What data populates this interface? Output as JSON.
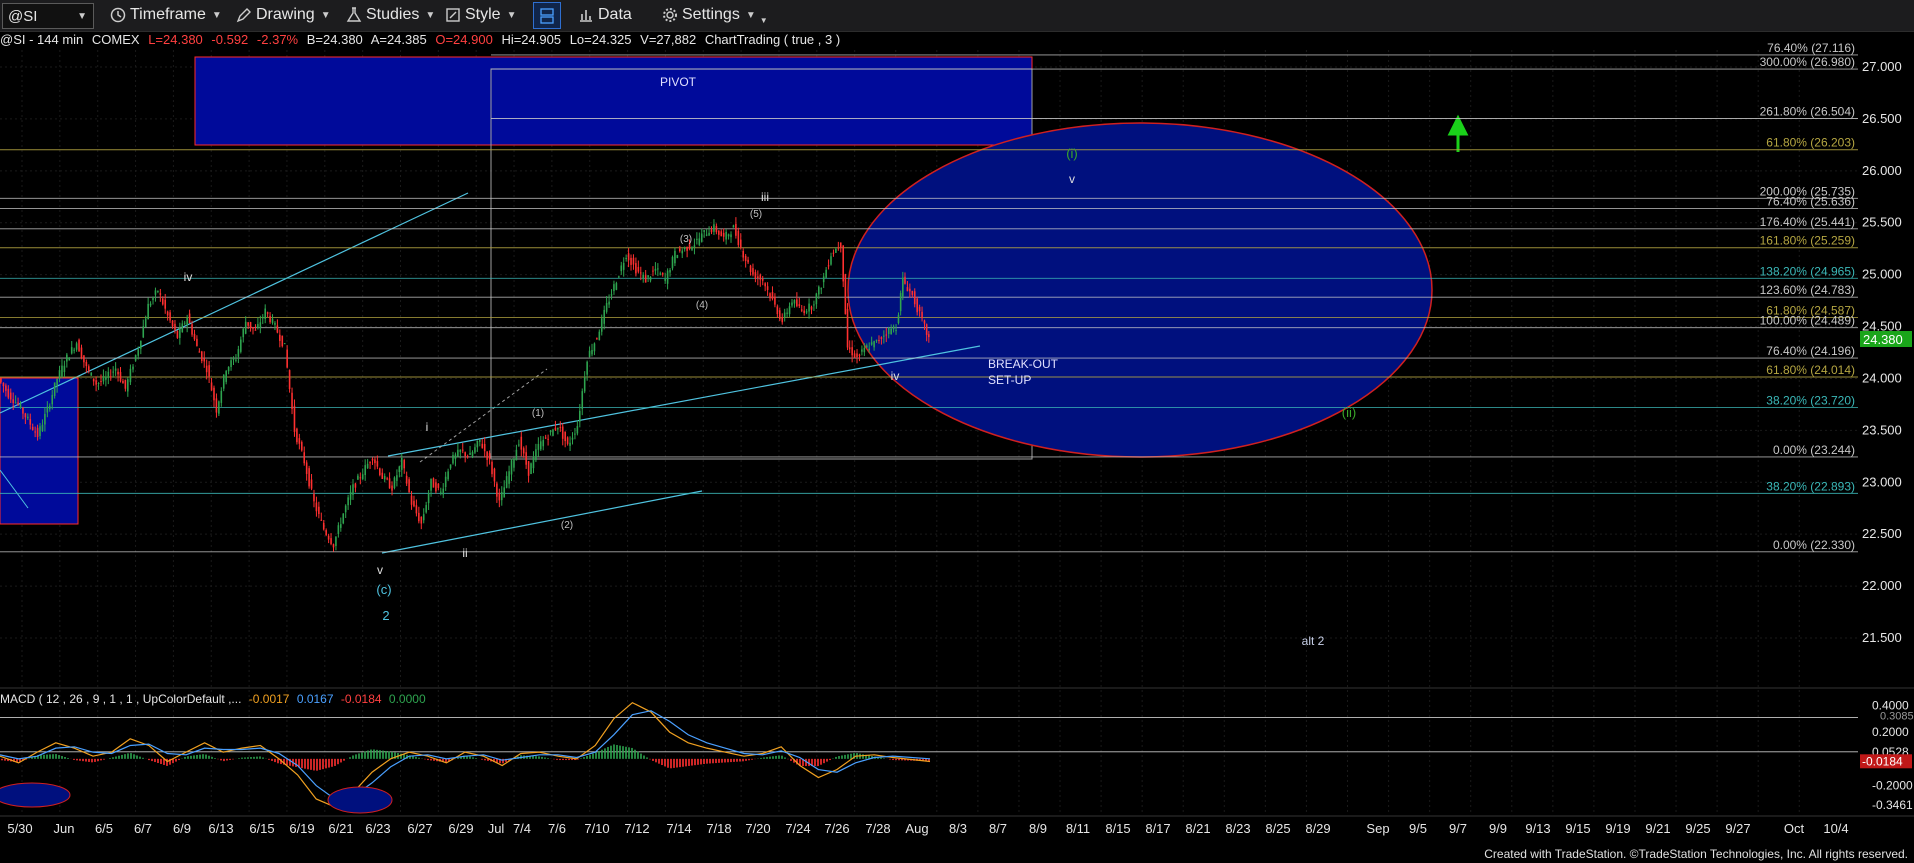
{
  "toolbar": {
    "symbol": "@SI",
    "timeframe": "Timeframe",
    "drawing": "Drawing",
    "studies": "Studies",
    "style": "Style",
    "data": "Data",
    "settings": "Settings"
  },
  "status": {
    "symbol": "@SI - 144 min",
    "exchange": "COMEX",
    "last": "L=24.380",
    "change": "-0.592",
    "change_pct": "-2.37%",
    "bid": "B=24.380",
    "ask": "A=24.385",
    "open": "O=24.900",
    "high": "Hi=24.905",
    "low": "Lo=24.325",
    "volume": "V=27,882",
    "study": "ChartTrading ( true , 3 )"
  },
  "macd_header": {
    "label": "MACD ( 12 , 26 , 9 , 1 , 1 , UpColorDefault ,...",
    "v1": "-0.0017",
    "v2": "0.0167",
    "v3": "-0.0184",
    "v4": "0.0000"
  },
  "footer": "Created with TradeStation. ©TradeStation Technologies, Inc. All rights reserved.",
  "colors": {
    "up": "#2ea44f",
    "down": "#ff3030",
    "price_tag": "#1aa51a",
    "fib_line": "#c8c8c8",
    "box_fill": "#000a9a",
    "ellipse_fill": "#00107e",
    "trend": "#4fc3e0",
    "green_label": "#3aa82a"
  },
  "chart_data": {
    "type": "candlestick",
    "instrument": "@SI - 144 min",
    "y_axis": {
      "ylim": [
        21.0,
        27.2
      ],
      "ticks": [
        "27.000",
        "26.500",
        "26.000",
        "25.500",
        "25.000",
        "24.500",
        "24.000",
        "23.500",
        "23.000",
        "22.500",
        "22.000",
        "21.500"
      ],
      "tick_values": [
        27.0,
        26.5,
        26.0,
        25.5,
        25.0,
        24.5,
        24.0,
        23.5,
        23.0,
        22.5,
        22.0,
        21.5
      ],
      "last_price_label": "24.380",
      "last_price": 24.38
    },
    "x_axis": {
      "labels": [
        "5/30",
        "Jun",
        "6/5",
        "6/7",
        "6/9",
        "6/13",
        "6/15",
        "6/19",
        "6/21",
        "6/23",
        "6/27",
        "6/29",
        "Jul",
        "7/4",
        "7/6",
        "7/10",
        "7/12",
        "7/14",
        "7/18",
        "7/20",
        "7/24",
        "7/26",
        "7/28",
        "Aug",
        "8/3",
        "8/7",
        "8/9",
        "8/11",
        "8/15",
        "8/17",
        "8/21",
        "8/23",
        "8/25",
        "8/29",
        "Sep",
        "9/5",
        "9/7",
        "9/9",
        "9/13",
        "9/15",
        "9/19",
        "9/21",
        "9/25",
        "9/27",
        "Oct",
        "10/4"
      ]
    },
    "price_path": [
      [
        0,
        24.0
      ],
      [
        0.006,
        23.85
      ],
      [
        0.012,
        23.75
      ],
      [
        0.018,
        23.6
      ],
      [
        0.024,
        23.45
      ],
      [
        0.03,
        23.7
      ],
      [
        0.036,
        24.0
      ],
      [
        0.042,
        24.2
      ],
      [
        0.048,
        24.35
      ],
      [
        0.054,
        24.1
      ],
      [
        0.06,
        23.95
      ],
      [
        0.066,
        24.0
      ],
      [
        0.072,
        24.1
      ],
      [
        0.078,
        23.9
      ],
      [
        0.086,
        24.3
      ],
      [
        0.092,
        24.7
      ],
      [
        0.098,
        24.85
      ],
      [
        0.104,
        24.6
      ],
      [
        0.11,
        24.4
      ],
      [
        0.116,
        24.6
      ],
      [
        0.122,
        24.3
      ],
      [
        0.128,
        24.1
      ],
      [
        0.134,
        23.7
      ],
      [
        0.14,
        24.1
      ],
      [
        0.146,
        24.2
      ],
      [
        0.152,
        24.55
      ],
      [
        0.158,
        24.45
      ],
      [
        0.164,
        24.65
      ],
      [
        0.17,
        24.5
      ],
      [
        0.176,
        24.3
      ],
      [
        0.182,
        23.5
      ],
      [
        0.188,
        23.2
      ],
      [
        0.194,
        22.8
      ],
      [
        0.2,
        22.55
      ],
      [
        0.206,
        22.4
      ],
      [
        0.212,
        22.7
      ],
      [
        0.218,
        22.95
      ],
      [
        0.224,
        23.1
      ],
      [
        0.23,
        23.25
      ],
      [
        0.236,
        23.05
      ],
      [
        0.242,
        22.95
      ],
      [
        0.248,
        23.2
      ],
      [
        0.254,
        22.8
      ],
      [
        0.26,
        22.6
      ],
      [
        0.266,
        23.0
      ],
      [
        0.272,
        22.9
      ],
      [
        0.278,
        23.2
      ],
      [
        0.284,
        23.3
      ],
      [
        0.29,
        23.25
      ],
      [
        0.296,
        23.4
      ],
      [
        0.302,
        23.2
      ],
      [
        0.308,
        22.8
      ],
      [
        0.314,
        23.1
      ],
      [
        0.32,
        23.4
      ],
      [
        0.326,
        23.1
      ],
      [
        0.332,
        23.35
      ],
      [
        0.338,
        23.45
      ],
      [
        0.344,
        23.55
      ],
      [
        0.35,
        23.35
      ],
      [
        0.356,
        23.55
      ],
      [
        0.362,
        24.2
      ],
      [
        0.368,
        24.4
      ],
      [
        0.374,
        24.7
      ],
      [
        0.38,
        24.95
      ],
      [
        0.386,
        25.2
      ],
      [
        0.392,
        25.05
      ],
      [
        0.398,
        24.95
      ],
      [
        0.404,
        25.05
      ],
      [
        0.41,
        24.95
      ],
      [
        0.416,
        25.2
      ],
      [
        0.422,
        25.25
      ],
      [
        0.428,
        25.3
      ],
      [
        0.434,
        25.4
      ],
      [
        0.44,
        25.45
      ],
      [
        0.446,
        25.35
      ],
      [
        0.452,
        25.45
      ],
      [
        0.458,
        25.2
      ],
      [
        0.464,
        25.0
      ],
      [
        0.47,
        24.95
      ],
      [
        0.476,
        24.75
      ],
      [
        0.482,
        24.55
      ],
      [
        0.488,
        24.75
      ],
      [
        0.494,
        24.65
      ],
      [
        0.5,
        24.7
      ],
      [
        0.506,
        24.9
      ],
      [
        0.512,
        25.2
      ],
      [
        0.518,
        25.3
      ],
      [
        0.522,
        24.3
      ],
      [
        0.528,
        24.2
      ],
      [
        0.534,
        24.3
      ],
      [
        0.54,
        24.35
      ],
      [
        0.546,
        24.45
      ],
      [
        0.552,
        24.5
      ],
      [
        0.556,
        24.95
      ],
      [
        0.562,
        24.8
      ],
      [
        0.568,
        24.55
      ],
      [
        0.572,
        24.38
      ]
    ],
    "fib_levels_right": [
      {
        "label": "76.40% (27.116)",
        "value": 27.116,
        "color": "#c8c8c8"
      },
      {
        "label": "300.00% (26.980)",
        "value": 26.98,
        "color": "#c8c8c8"
      },
      {
        "label": "261.80% (26.504)",
        "value": 26.504,
        "color": "#c8c8c8"
      },
      {
        "label": "61.80% (26.203)",
        "value": 26.203,
        "color": "#b5a642"
      },
      {
        "label": "200.00% (25.735)",
        "value": 25.735,
        "color": "#c8c8c8"
      },
      {
        "label": "76.40% (25.636)",
        "value": 25.636,
        "color": "#c8c8c8"
      },
      {
        "label": "176.40% (25.441)",
        "value": 25.441,
        "color": "#c8c8c8"
      },
      {
        "label": "161.80% (25.259)",
        "value": 25.259,
        "color": "#b5a642"
      },
      {
        "label": "138.20% (24.965)",
        "value": 24.965,
        "color": "#3bb8b8"
      },
      {
        "label": "123.60% (24.783)",
        "value": 24.783,
        "color": "#c8c8c8"
      },
      {
        "label": "61.80% (24.587)",
        "value": 24.587,
        "color": "#b5a642"
      },
      {
        "label": "100.00% (24.489)",
        "value": 24.489,
        "color": "#c8c8c8"
      },
      {
        "label": "76.40% (24.196)",
        "value": 24.196,
        "color": "#c8c8c8"
      },
      {
        "label": "61.80% (24.014)",
        "value": 24.014,
        "color": "#b5a642"
      },
      {
        "label": "38.20% (23.720)",
        "value": 23.72,
        "color": "#3bb8b8"
      },
      {
        "label": "0.00% (23.244)",
        "value": 23.244,
        "color": "#c8c8c8"
      },
      {
        "label": "38.20% (22.893)",
        "value": 22.893,
        "color": "#3bb8b8"
      },
      {
        "label": "0.00% (22.330)",
        "value": 22.33,
        "color": "#c8c8c8"
      }
    ],
    "annotations": [
      {
        "text": "PIVOT",
        "kind": "box-label"
      },
      {
        "text": "BREAK-OUT",
        "kind": "text"
      },
      {
        "text": "SET-UP",
        "kind": "text"
      },
      {
        "text": "iv",
        "kind": "wave"
      },
      {
        "text": "v",
        "kind": "wave"
      },
      {
        "text": "(c)",
        "kind": "wave"
      },
      {
        "text": "2",
        "kind": "wave"
      },
      {
        "text": "i",
        "kind": "wave"
      },
      {
        "text": "ii",
        "kind": "wave"
      },
      {
        "text": "(1)",
        "kind": "wave"
      },
      {
        "text": "(2)",
        "kind": "wave"
      },
      {
        "text": "(3)",
        "kind": "wave"
      },
      {
        "text": "(4)",
        "kind": "wave"
      },
      {
        "text": "(5)",
        "kind": "wave"
      },
      {
        "text": "iii",
        "kind": "wave"
      },
      {
        "text": "iv",
        "kind": "wave"
      },
      {
        "text": "(i)",
        "kind": "wave"
      },
      {
        "text": "v",
        "kind": "wave"
      },
      {
        "text": "(ii)",
        "kind": "wave"
      },
      {
        "text": "alt 2",
        "kind": "text"
      }
    ],
    "macd": {
      "ticks": [
        "0.3085",
        "0.4000",
        "0.2000",
        "0.0528",
        "-0.0184",
        "-0.2000",
        "-0.3461"
      ],
      "tick_values": [
        0.3085,
        0.4,
        0.2,
        0.0528,
        -0.0184,
        -0.2,
        -0.3461
      ],
      "ylim": [
        -0.42,
        0.44
      ],
      "macd_line": [
        [
          0,
          0.02
        ],
        [
          0.02,
          -0.03
        ],
        [
          0.04,
          0.05
        ],
        [
          0.06,
          0.12
        ],
        [
          0.08,
          0.08
        ],
        [
          0.1,
          0.02
        ],
        [
          0.12,
          0.05
        ],
        [
          0.14,
          0.15
        ],
        [
          0.16,
          0.1
        ],
        [
          0.18,
          -0.02
        ],
        [
          0.2,
          0.05
        ],
        [
          0.22,
          0.12
        ],
        [
          0.24,
          0.05
        ],
        [
          0.26,
          0.08
        ],
        [
          0.28,
          0.1
        ],
        [
          0.3,
          0.0
        ],
        [
          0.32,
          -0.12
        ],
        [
          0.34,
          -0.3
        ],
        [
          0.36,
          -0.36
        ],
        [
          0.38,
          -0.25
        ],
        [
          0.4,
          -0.1
        ],
        [
          0.42,
          0.0
        ],
        [
          0.44,
          0.05
        ],
        [
          0.46,
          0.02
        ],
        [
          0.48,
          -0.03
        ],
        [
          0.5,
          0.05
        ],
        [
          0.52,
          0.02
        ],
        [
          0.54,
          -0.05
        ],
        [
          0.56,
          0.04
        ],
        [
          0.58,
          0.05
        ],
        [
          0.6,
          0.02
        ],
        [
          0.62,
          0.0
        ],
        [
          0.64,
          0.1
        ],
        [
          0.66,
          0.3
        ],
        [
          0.68,
          0.42
        ],
        [
          0.7,
          0.35
        ],
        [
          0.72,
          0.2
        ],
        [
          0.74,
          0.12
        ],
        [
          0.76,
          0.08
        ],
        [
          0.78,
          0.05
        ],
        [
          0.8,
          0.02
        ],
        [
          0.82,
          0.04
        ],
        [
          0.84,
          0.09
        ],
        [
          0.86,
          -0.05
        ],
        [
          0.88,
          -0.14
        ],
        [
          0.9,
          -0.08
        ],
        [
          0.92,
          0.02
        ],
        [
          0.94,
          0.03
        ],
        [
          0.96,
          0.01
        ],
        [
          1.0,
          -0.02
        ]
      ],
      "signal_line": [
        [
          0,
          0.03
        ],
        [
          0.02,
          0.0
        ],
        [
          0.04,
          0.02
        ],
        [
          0.06,
          0.08
        ],
        [
          0.08,
          0.09
        ],
        [
          0.1,
          0.05
        ],
        [
          0.12,
          0.04
        ],
        [
          0.14,
          0.1
        ],
        [
          0.16,
          0.11
        ],
        [
          0.18,
          0.04
        ],
        [
          0.2,
          0.03
        ],
        [
          0.22,
          0.08
        ],
        [
          0.24,
          0.07
        ],
        [
          0.26,
          0.07
        ],
        [
          0.28,
          0.08
        ],
        [
          0.3,
          0.04
        ],
        [
          0.32,
          -0.05
        ],
        [
          0.34,
          -0.2
        ],
        [
          0.36,
          -0.3
        ],
        [
          0.38,
          -0.28
        ],
        [
          0.4,
          -0.18
        ],
        [
          0.42,
          -0.06
        ],
        [
          0.44,
          0.02
        ],
        [
          0.46,
          0.03
        ],
        [
          0.48,
          0.0
        ],
        [
          0.5,
          0.02
        ],
        [
          0.52,
          0.03
        ],
        [
          0.54,
          -0.01
        ],
        [
          0.56,
          0.01
        ],
        [
          0.58,
          0.03
        ],
        [
          0.6,
          0.03
        ],
        [
          0.62,
          0.01
        ],
        [
          0.64,
          0.05
        ],
        [
          0.66,
          0.18
        ],
        [
          0.68,
          0.33
        ],
        [
          0.7,
          0.36
        ],
        [
          0.72,
          0.28
        ],
        [
          0.74,
          0.18
        ],
        [
          0.76,
          0.12
        ],
        [
          0.78,
          0.08
        ],
        [
          0.8,
          0.04
        ],
        [
          0.82,
          0.03
        ],
        [
          0.84,
          0.06
        ],
        [
          0.86,
          0.01
        ],
        [
          0.88,
          -0.08
        ],
        [
          0.9,
          -0.1
        ],
        [
          0.92,
          -0.03
        ],
        [
          0.94,
          0.01
        ],
        [
          0.96,
          0.02
        ],
        [
          1.0,
          0.0
        ]
      ]
    }
  }
}
